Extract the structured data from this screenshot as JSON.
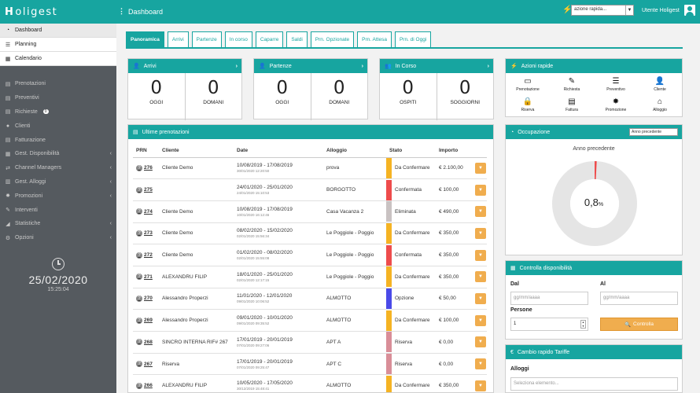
{
  "app": {
    "logo_text": "oligest",
    "logo_initial": "H",
    "page_title": "Dashboard"
  },
  "topbar": {
    "quick_action_placeholder": "azione rapida...",
    "user_name": "Utente Holigest"
  },
  "sidebar": {
    "top_items": [
      {
        "label": "Dashboard",
        "icon": "dashboard-icon"
      },
      {
        "label": "Planning",
        "icon": "list-icon"
      },
      {
        "label": "Calendario",
        "icon": "calendar-icon"
      }
    ],
    "items": [
      {
        "label": "Prenotazioni",
        "icon": "file-icon"
      },
      {
        "label": "Preventivi",
        "icon": "file-icon"
      },
      {
        "label": "Richieste",
        "icon": "file-icon",
        "badge": "0"
      },
      {
        "label": "Clienti",
        "icon": "users-icon"
      },
      {
        "label": "Fatturazione",
        "icon": "file-icon"
      },
      {
        "label": "Gest. Disponibilità",
        "icon": "calendar-icon",
        "chevron": "‹"
      },
      {
        "label": "Channel Managers",
        "icon": "exchange-icon",
        "chevron": "‹"
      },
      {
        "label": "Gest. Alloggi",
        "icon": "building-icon",
        "chevron": "‹"
      },
      {
        "label": "Promozioni",
        "icon": "star-icon",
        "chevron": "‹"
      },
      {
        "label": "Interventi",
        "icon": "wrench-icon"
      },
      {
        "label": "Statistiche",
        "icon": "chart-icon",
        "chevron": "‹"
      },
      {
        "label": "Opzioni",
        "icon": "gear-icon",
        "chevron": "‹"
      }
    ],
    "clock": {
      "date": "25/02/2020",
      "time": "15:25:04"
    }
  },
  "tabs": [
    "Panoramica",
    "Arrivi",
    "Partenze",
    "In corso",
    "Caparre",
    "Saldi",
    "Prn. Opzionate",
    "Prn. Attesa",
    "Prn. di Oggi"
  ],
  "counters": {
    "arrivi": {
      "title": "Arrivi",
      "left_value": "0",
      "left_label": "OGGI",
      "right_value": "0",
      "right_label": "DOMANI"
    },
    "partenze": {
      "title": "Partenze",
      "left_value": "0",
      "left_label": "OGGI",
      "right_value": "0",
      "right_label": "DOMANI"
    },
    "in_corso": {
      "title": "In Corso",
      "left_value": "0",
      "left_label": "OSPITI",
      "right_value": "0",
      "right_label": "SOGGIORNI"
    }
  },
  "quick_actions": {
    "title": "Azioni rapide",
    "items": [
      {
        "label": "Prenotazione",
        "icon": "ticket-icon"
      },
      {
        "label": "Richiesta",
        "icon": "pencil-icon"
      },
      {
        "label": "Preventivo",
        "icon": "list-icon"
      },
      {
        "label": "Cliente",
        "icon": "add-user-icon"
      },
      {
        "label": "Riserva",
        "icon": "lock-icon"
      },
      {
        "label": "Fattura",
        "icon": "file-icon"
      },
      {
        "label": "Promozione",
        "icon": "badge-icon"
      },
      {
        "label": "Alloggio",
        "icon": "home-icon"
      }
    ]
  },
  "bookings": {
    "title": "Ultime prenotazioni",
    "columns": [
      "PRN",
      "Cliente",
      "Date",
      "Alloggio",
      "Stato",
      "Importo"
    ],
    "rows": [
      {
        "prn": "276",
        "cliente": "Cliente Demo",
        "date": "10/08/2019 - 17/08/2019",
        "created": "30/01/2020 12:20:50",
        "alloggio": "prova",
        "stato": "Da Confermare",
        "color": "#f5b323",
        "importo": "€ 2.100,00"
      },
      {
        "prn": "275",
        "cliente": "",
        "date": "24/01/2020 - 25/01/2020",
        "created": "24/01/2020 15:10:53",
        "alloggio": "BORGOTTO",
        "stato": "Confermata",
        "color": "#ee4c4c",
        "importo": "€ 100,00"
      },
      {
        "prn": "274",
        "cliente": "Cliente Demo",
        "date": "10/08/2019 - 17/08/2019",
        "created": "10/01/2020 16:12:46",
        "alloggio": "Casa Vacanza 2",
        "stato": "Eliminata",
        "color": "#c9c2c2",
        "importo": "€ 490,00"
      },
      {
        "prn": "273",
        "cliente": "Cliente Demo",
        "date": "08/02/2020 - 15/02/2020",
        "created": "02/01/2020 15:56:34",
        "alloggio": "Le Poggiole - Poggio",
        "stato": "Da Confermare",
        "color": "#f5b323",
        "importo": "€ 350,00"
      },
      {
        "prn": "272",
        "cliente": "Cliente Demo",
        "date": "01/02/2020 - 08/02/2020",
        "created": "02/01/2020 15:55:08",
        "alloggio": "Le Poggiole - Poggio",
        "stato": "Confermata",
        "color": "#ee4c4c",
        "importo": "€ 350,00"
      },
      {
        "prn": "271",
        "cliente": "ALEXANDRU FILIP",
        "date": "18/01/2020 - 25/01/2020",
        "created": "02/01/2020 12:17:15",
        "alloggio": "Le Poggiole - Poggio",
        "stato": "Da Confermare",
        "color": "#f5b323",
        "importo": "€ 350,00"
      },
      {
        "prn": "270",
        "cliente": "Alessandro Properzi",
        "date": "11/01/2020 - 12/01/2020",
        "created": "09/01/2020 10:06:52",
        "alloggio": "ALMOTTO",
        "stato": "Opzione",
        "color": "#4a4ae8",
        "importo": "€ 50,00"
      },
      {
        "prn": "269",
        "cliente": "Alessandro Properzi",
        "date": "09/01/2020 - 10/01/2020",
        "created": "09/01/2020 09:35:52",
        "alloggio": "ALMOTTO",
        "stato": "Da Confermare",
        "color": "#f5b323",
        "importo": "€ 100,00"
      },
      {
        "prn": "268",
        "cliente": "SINCRO INTERNA RIF# 267",
        "date": "17/01/2019 - 20/01/2019",
        "created": "07/01/2020 09:27:06",
        "alloggio": "APT A",
        "stato": "Riserva",
        "color": "#d98e98",
        "importo": "€ 0,00"
      },
      {
        "prn": "267",
        "cliente": "Riserva",
        "date": "17/01/2019 - 20/01/2019",
        "created": "07/01/2020 09:25:47",
        "alloggio": "APT C",
        "stato": "Riserva",
        "color": "#d98e98",
        "importo": "€ 0,00"
      },
      {
        "prn": "266",
        "cliente": "ALEXANDRU FILIP",
        "date": "10/05/2020 - 17/05/2020",
        "created": "30/12/2019 15:48:41",
        "alloggio": "ALMOTTO",
        "stato": "Da Confermare",
        "color": "#f5b323",
        "importo": "€ 350,00"
      }
    ]
  },
  "occupancy": {
    "title": "Occupazione",
    "select_value": "Anno precedente",
    "caption": "Anno precedente",
    "value": "0,8",
    "unit": "%",
    "fraction": 0.008,
    "colors": {
      "filled": "#ee4c4c",
      "empty": "#e5e5e5"
    }
  },
  "availability": {
    "title": "Controlla disponibilità",
    "from_label": "Dal",
    "to_label": "Al",
    "date_placeholder": "gg/mm/aaaa",
    "persons_label": "Persone",
    "persons_value": "1",
    "button_label": "Controlla"
  },
  "rates": {
    "title": "Cambio rapido Tariffe",
    "alloggi_label": "Alloggi",
    "select_placeholder": "Seleziona elemento..."
  },
  "colors": {
    "accent": "#17a5a0",
    "sidebar": "#555a5f",
    "button": "#f0ad4e"
  }
}
